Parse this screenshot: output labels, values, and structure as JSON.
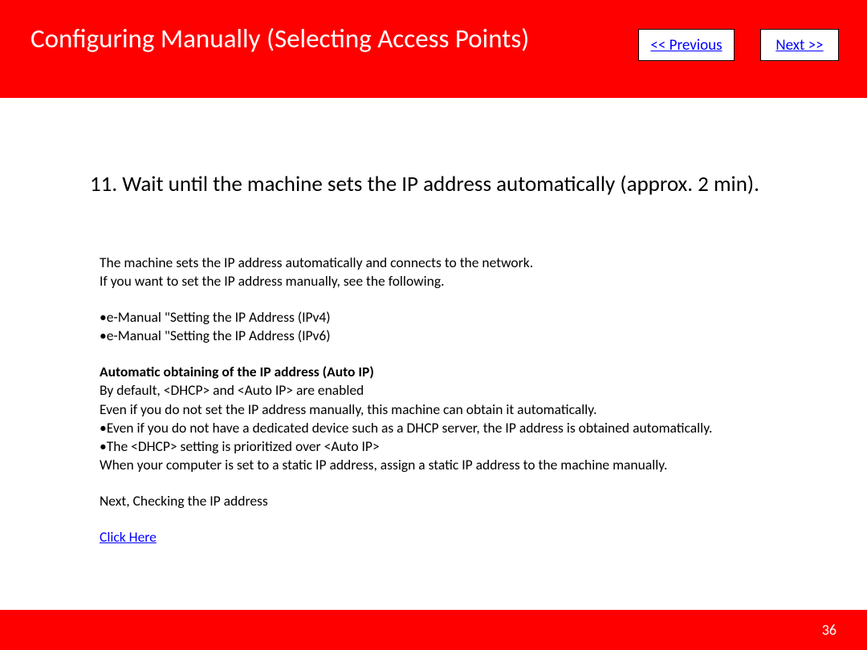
{
  "header": {
    "title": "Configuring Manually (Selecting Access Points)",
    "prev_label": "<< Previous",
    "next_label": "Next >>"
  },
  "content": {
    "heading": "11. Wait until the machine sets the IP address automatically (approx. 2 min).",
    "p1": "The machine sets the IP address automatically and connects to the network.",
    "p2": "If you want to set the IP address manually, see the following.",
    "p3": "•e-Manual \"Setting the IP Address (IPv4)",
    "p4": "•e-Manual \"Setting the IP Address (IPv6)",
    "p5": "Automatic obtaining of the IP address (Auto IP)",
    "p6": "By default, <DHCP> and <Auto IP> are enabled",
    "p7": "Even if you do not set the IP address manually, this machine can obtain it automatically.",
    "p8": "•Even if you do not have a dedicated device such as a DHCP server, the IP address is obtained automatically.",
    "p9": "•The <DHCP> setting is prioritized over <Auto IP>",
    "p10": "When your computer is set to a static IP address, assign a static IP address to the machine manually.",
    "p11": "Next, Checking the IP address",
    "click_here": "Click Here"
  },
  "footer": {
    "page_number": "36"
  }
}
